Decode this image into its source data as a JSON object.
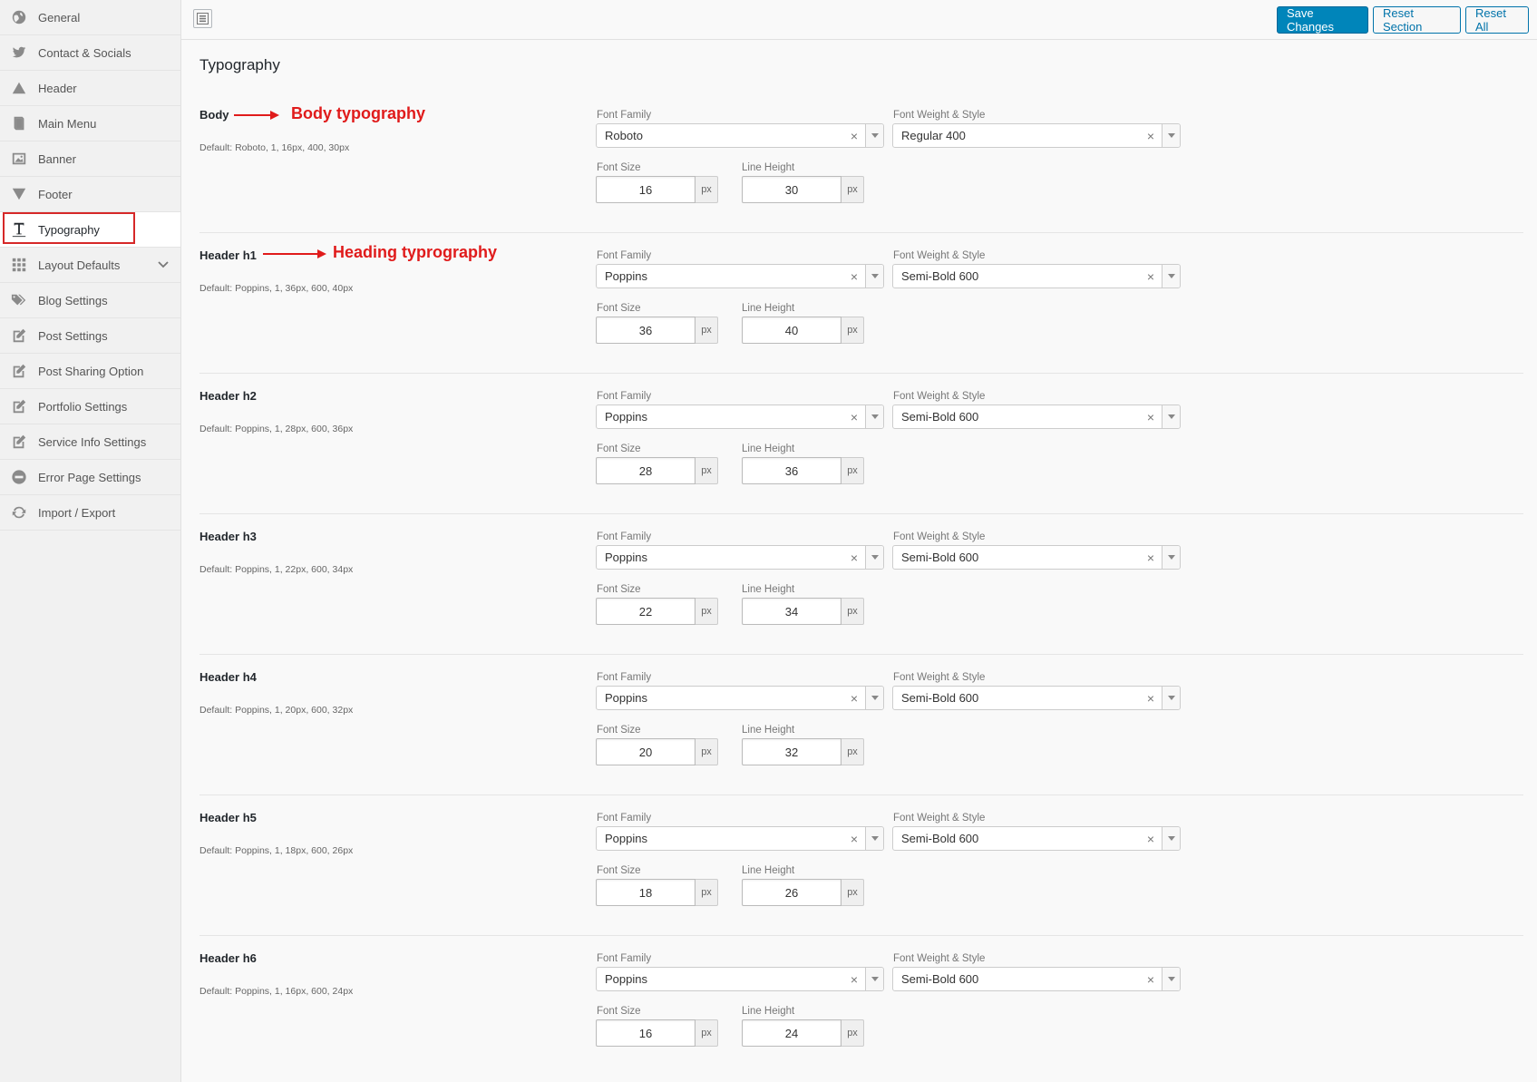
{
  "toolbar": {
    "save_label": "Save Changes",
    "reset_section_label": "Reset Section",
    "reset_all_label": "Reset All"
  },
  "sidebar": {
    "items": [
      {
        "label": "General",
        "icon": "globe-icon"
      },
      {
        "label": "Contact & Socials",
        "icon": "twitter-icon"
      },
      {
        "label": "Header",
        "icon": "triangle-up-icon"
      },
      {
        "label": "Main Menu",
        "icon": "book-icon"
      },
      {
        "label": "Banner",
        "icon": "image-icon"
      },
      {
        "label": "Footer",
        "icon": "triangle-down-icon"
      },
      {
        "label": "Typography",
        "icon": "text-icon"
      },
      {
        "label": "Layout Defaults",
        "icon": "grid-icon"
      },
      {
        "label": "Blog Settings",
        "icon": "tags-icon"
      },
      {
        "label": "Post Settings",
        "icon": "edit-icon"
      },
      {
        "label": "Post Sharing Option",
        "icon": "edit-icon"
      },
      {
        "label": "Portfolio Settings",
        "icon": "edit-icon"
      },
      {
        "label": "Service Info Settings",
        "icon": "edit-icon"
      },
      {
        "label": "Error Page Settings",
        "icon": "minus-circle-icon"
      },
      {
        "label": "Import / Export",
        "icon": "refresh-icon"
      }
    ]
  },
  "page": {
    "title": "Typography"
  },
  "labels": {
    "font_family": "Font Family",
    "font_weight_style": "Font Weight & Style",
    "font_size": "Font Size",
    "line_height": "Line Height",
    "unit": "px"
  },
  "annotations": {
    "body": "Body typography",
    "heading": "Heading typrography"
  },
  "sections": [
    {
      "title": "Body",
      "default": "Default: Roboto, 1, 16px, 400, 30px",
      "font_family": "Roboto",
      "weight": "Regular 400",
      "size": "16",
      "line_height": "30"
    },
    {
      "title": "Header h1",
      "default": "Default: Poppins, 1, 36px, 600, 40px",
      "font_family": "Poppins",
      "weight": "Semi-Bold 600",
      "size": "36",
      "line_height": "40"
    },
    {
      "title": "Header h2",
      "default": "Default: Poppins, 1, 28px, 600, 36px",
      "font_family": "Poppins",
      "weight": "Semi-Bold 600",
      "size": "28",
      "line_height": "36"
    },
    {
      "title": "Header h3",
      "default": "Default: Poppins, 1, 22px, 600, 34px",
      "font_family": "Poppins",
      "weight": "Semi-Bold 600",
      "size": "22",
      "line_height": "34"
    },
    {
      "title": "Header h4",
      "default": "Default: Poppins, 1, 20px, 600, 32px",
      "font_family": "Poppins",
      "weight": "Semi-Bold 600",
      "size": "20",
      "line_height": "32"
    },
    {
      "title": "Header h5",
      "default": "Default: Poppins, 1, 18px, 600, 26px",
      "font_family": "Poppins",
      "weight": "Semi-Bold 600",
      "size": "18",
      "line_height": "26"
    },
    {
      "title": "Header h6",
      "default": "Default: Poppins, 1, 16px, 600, 24px",
      "font_family": "Poppins",
      "weight": "Semi-Bold 600",
      "size": "16",
      "line_height": "24"
    }
  ],
  "colors": {
    "primary": "#0085ba",
    "annotation": "#e01b1b"
  }
}
